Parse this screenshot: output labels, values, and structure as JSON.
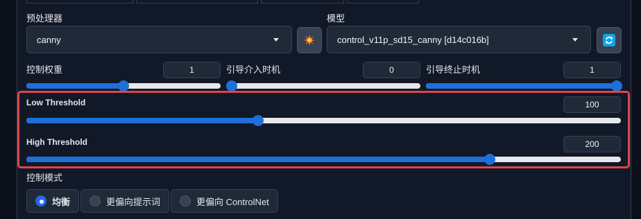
{
  "preprocessor": {
    "label": "预处理器",
    "value": "canny",
    "run_icon": "explosion-icon"
  },
  "model": {
    "label": "模型",
    "value": "control_v11p_sd15_canny [d14c016b]",
    "refresh_icon": "refresh-icon"
  },
  "control_weight": {
    "label": "控制权重",
    "value": "1",
    "level": 0.5
  },
  "start_step": {
    "label": "引导介入时机",
    "value": "0",
    "level": 0.0
  },
  "end_step": {
    "label": "引导终止时机",
    "value": "1",
    "level": 1.0
  },
  "low_threshold": {
    "label": "Low Threshold",
    "value": "100",
    "level": 0.39
  },
  "high_threshold": {
    "label": "High Threshold",
    "value": "200",
    "level": 0.78
  },
  "control_mode": {
    "label": "控制模式",
    "options": [
      "均衡",
      "更偏向提示词",
      "更偏向 ControlNet"
    ],
    "selected": "均衡"
  },
  "colors": {
    "accent": "#1e6fd9",
    "highlight": "#e0454a",
    "background": "#0b0f19"
  }
}
